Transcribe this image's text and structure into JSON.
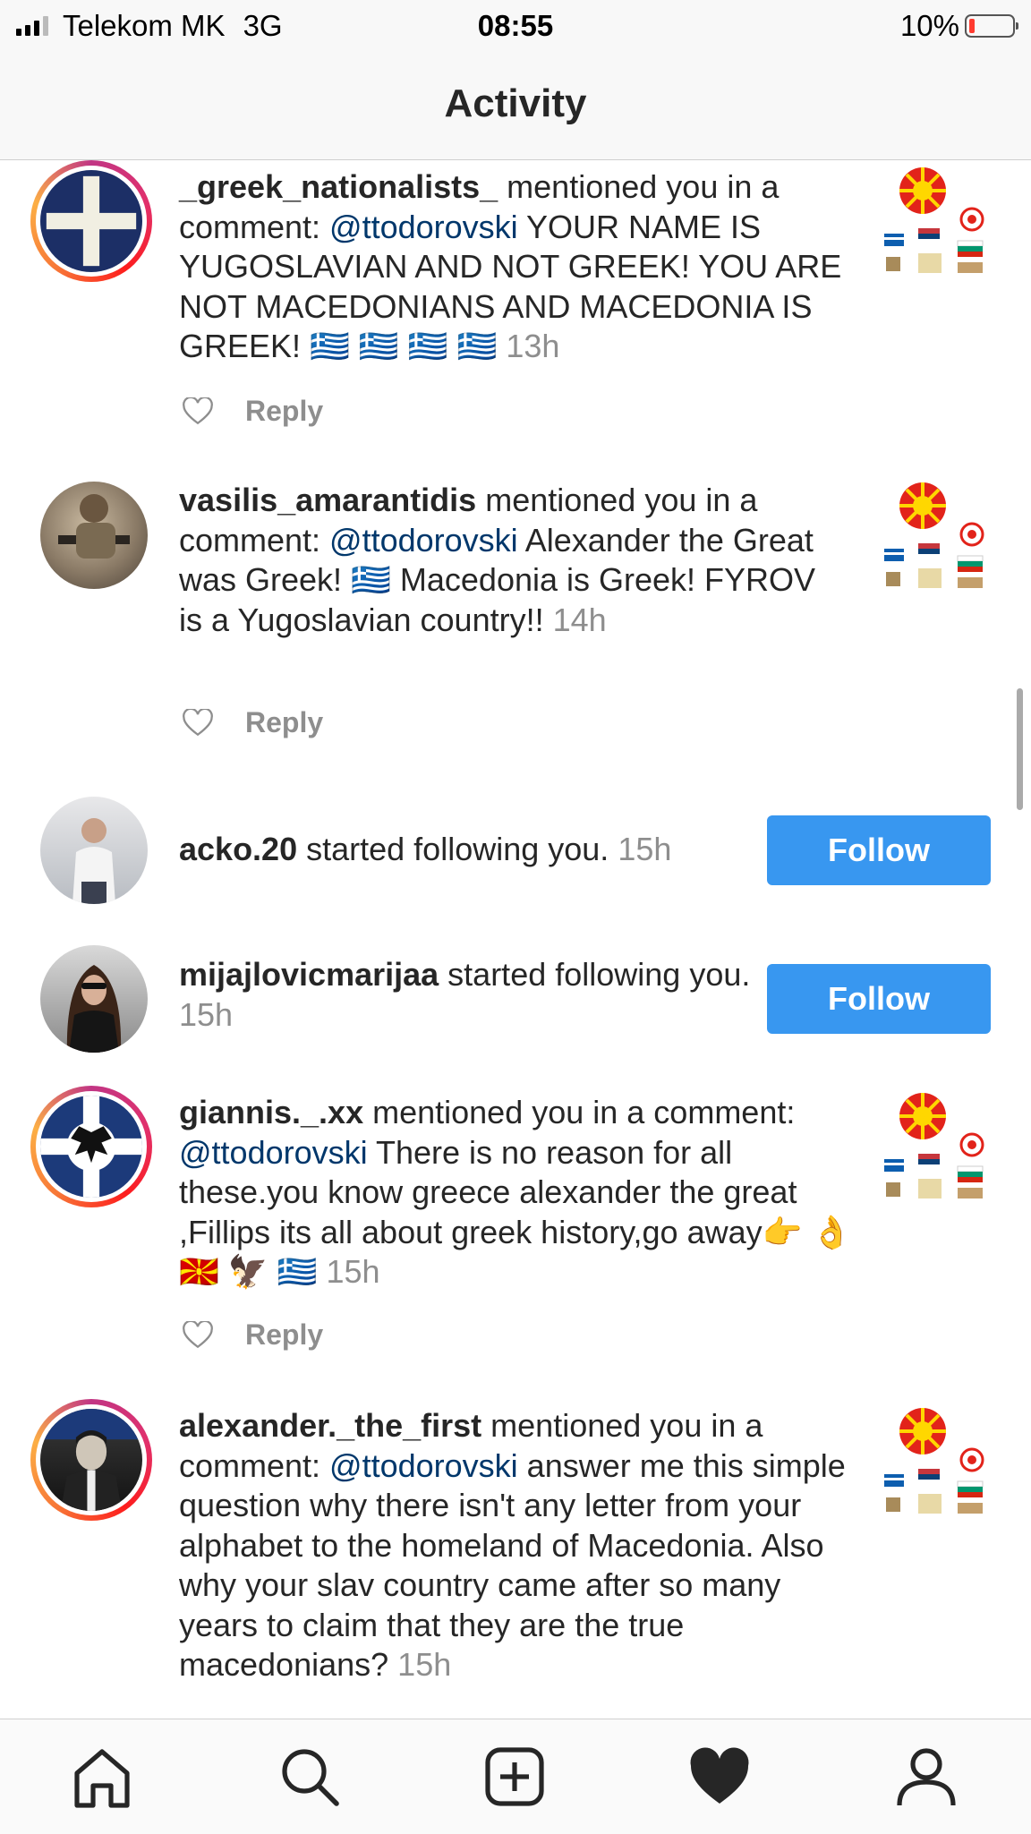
{
  "status": {
    "carrier": "Telekom MK",
    "network": "3G",
    "time": "08:55",
    "battery": "10%"
  },
  "header": {
    "title": "Activity"
  },
  "colors": {
    "follow_button": "#3897f0",
    "mention": "#00376b",
    "secondary_text": "#8e8e8e"
  },
  "actions": {
    "reply": "Reply",
    "follow": "Follow"
  },
  "activities": [
    {
      "username": "_greek_nationalists_",
      "action": " mentioned you in a comment: ",
      "mention": "@ttodorovski",
      "message": " YOUR NAME IS YUGOSLAVIAN AND NOT GREEK! YOU ARE NOT MACEDONIANS AND MACEDONIA IS GREEK! 🇬🇷 🇬🇷 🇬🇷 🇬🇷 ",
      "time": "13h"
    },
    {
      "username": "vasilis_amarantidis",
      "action": " mentioned you in a comment: ",
      "mention": "@ttodorovski",
      "message": " Alexander the Great was Greek! 🇬🇷 Macedonia is Greek! FYROV is a Yugoslavian country!! ",
      "time": "14h"
    },
    {
      "username": "acko.20",
      "action": " started following you. ",
      "time": "15h"
    },
    {
      "username": "mijajlovicmarijaa",
      "action": " started following you. ",
      "time": "15h"
    },
    {
      "username": "giannis._.xx",
      "action": " mentioned you in a comment: ",
      "mention": "@ttodorovski",
      "message": " There is no reason for all these.you know greece alexander the great ,Fillips its all about greek history,go away👉 👌 🇲🇰 🦅 🇬🇷 ",
      "time": "15h"
    },
    {
      "username": "alexander._the_first",
      "action": " mentioned you in a comment: ",
      "mention": "@ttodorovski",
      "message": " answer me this simple question why there isn't any letter from your alphabet to the homeland of Macedonia. Also why your slav country came after so many years to claim that they are the true macedonians? ",
      "time": "15h"
    }
  ],
  "tabs": [
    "home-icon",
    "search-icon",
    "new-post-icon",
    "activity-heart-icon",
    "profile-icon"
  ]
}
